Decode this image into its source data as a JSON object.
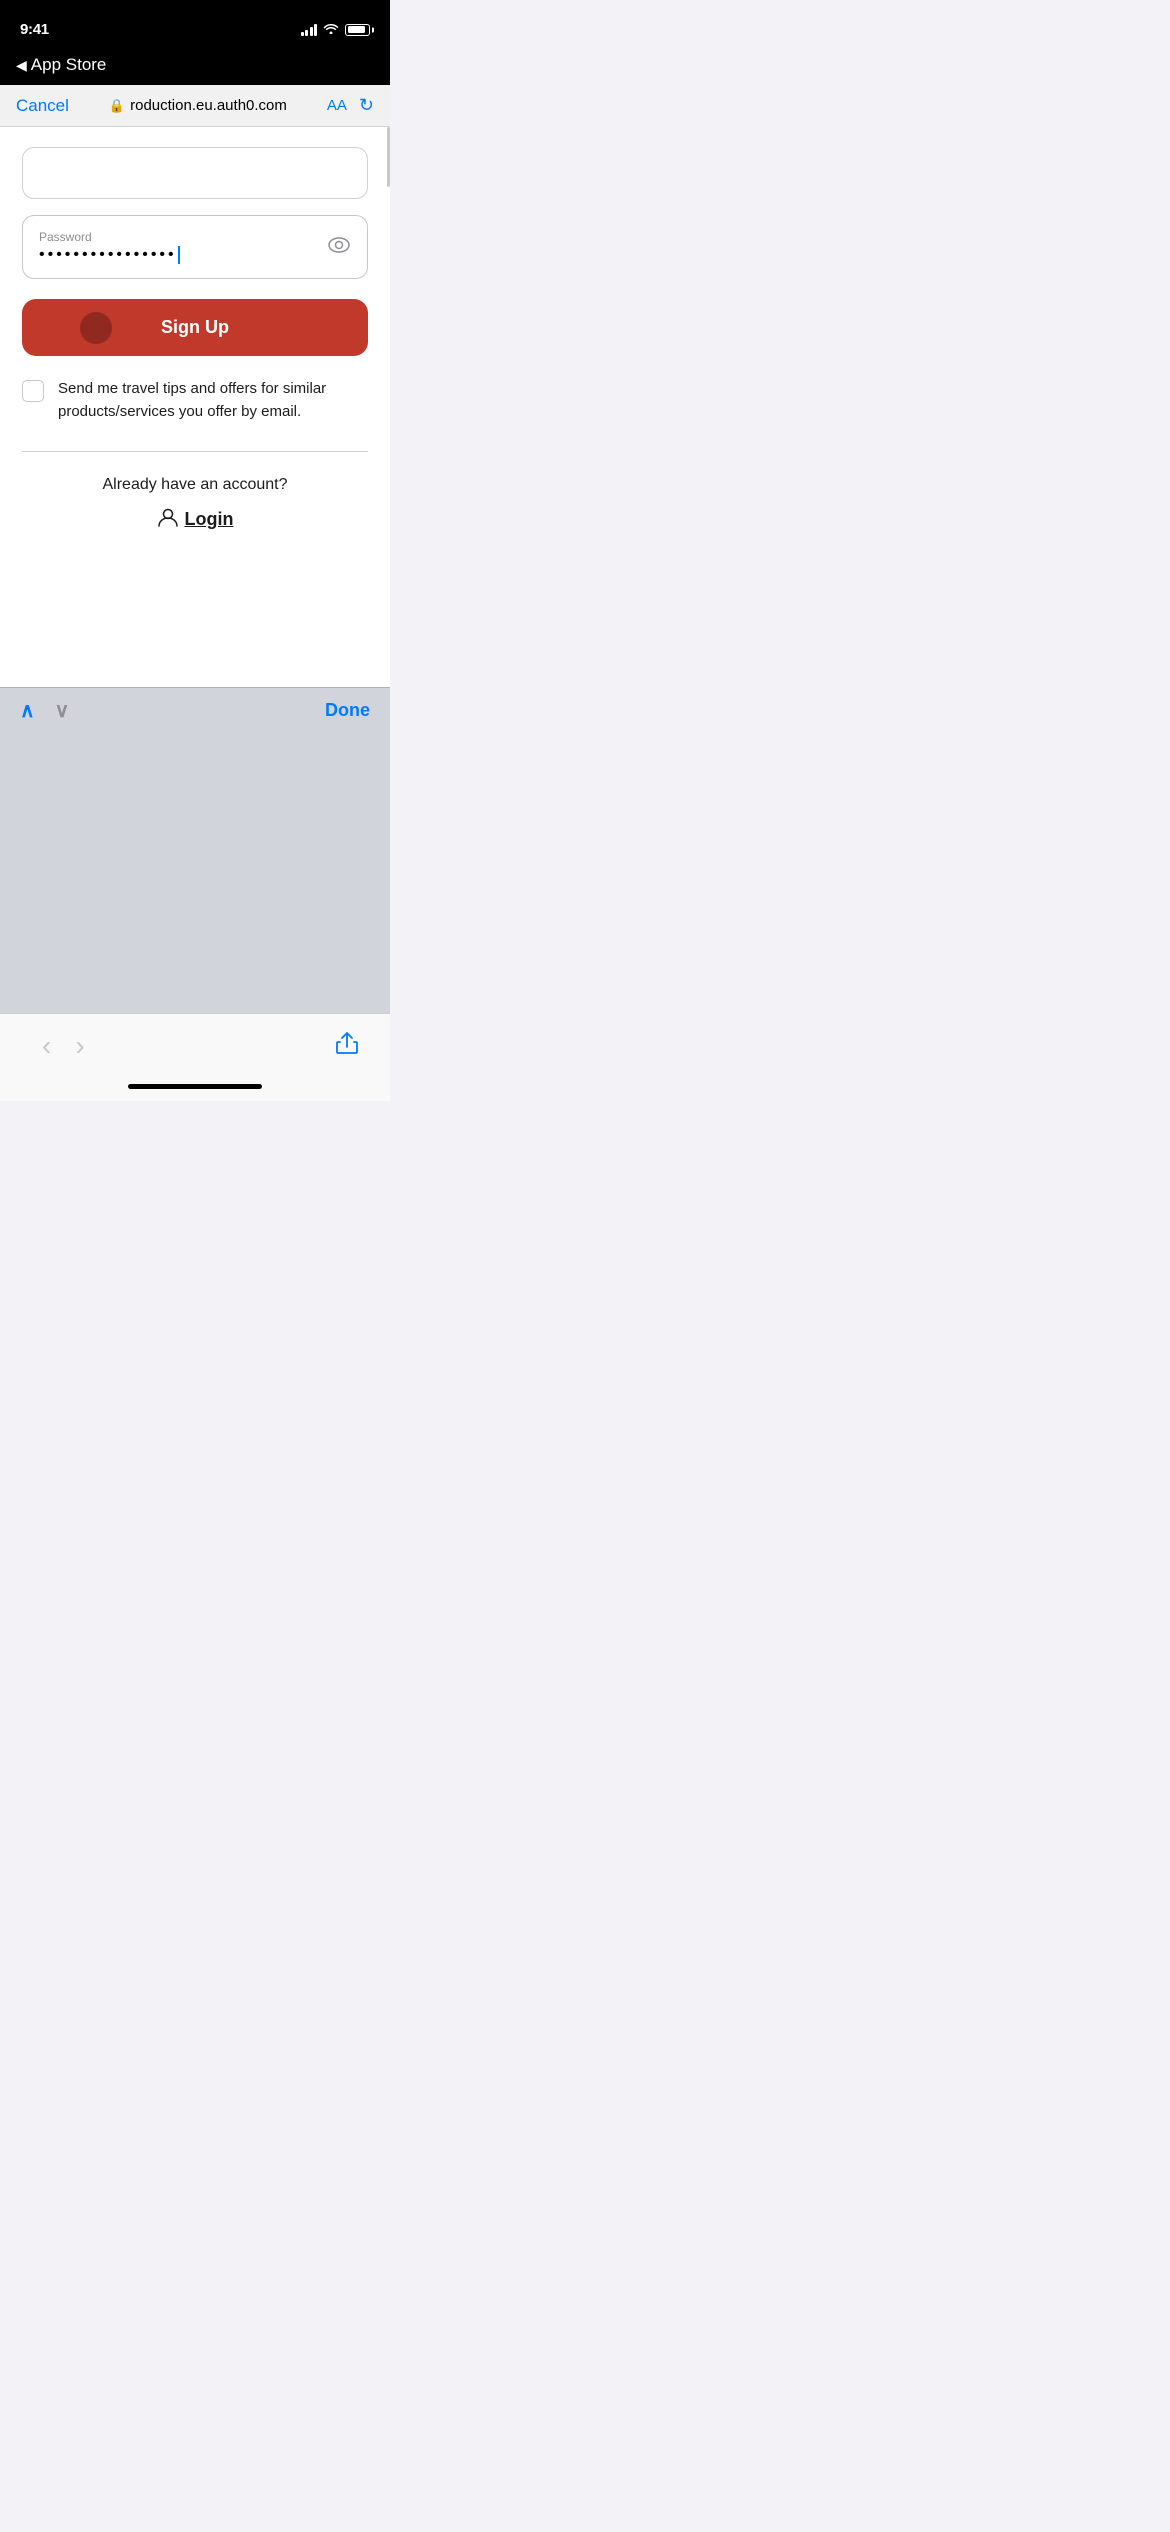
{
  "statusBar": {
    "time": "9:41",
    "backLabel": "App Store"
  },
  "browserBar": {
    "cancelLabel": "Cancel",
    "lockIcon": "🔒",
    "url": "roduction.eu.auth0.com",
    "aaLabel": "AA",
    "refreshIcon": "↻"
  },
  "form": {
    "passwordField": {
      "label": "Password",
      "value": "••••••••••••••••",
      "eyeIcon": "👁"
    },
    "signUpButton": "Sign Up",
    "checkboxLabel": "Send me travel tips and offers for similar products/services you offer by email.",
    "alreadyText": "Already have an account?",
    "loginLabel": "Login"
  },
  "keyboardToolbar": {
    "doneLabel": "Done"
  },
  "bottomBar": {
    "backLabel": "‹",
    "forwardLabel": "›",
    "shareLabel": "⬆"
  }
}
